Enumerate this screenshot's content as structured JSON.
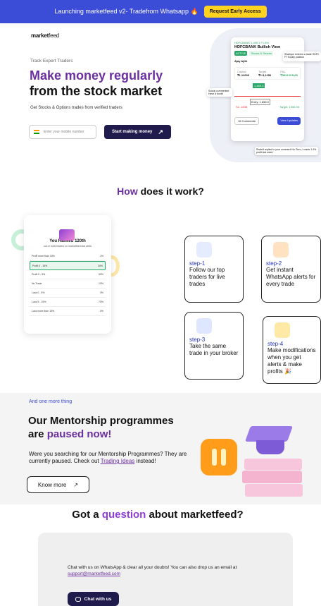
{
  "banner": {
    "text": "Launching marketfeed v2- Tradefrom Whatsapp 🔥",
    "button": "Request Early Access"
  },
  "logo": {
    "bold": "market",
    "rest": "feed"
  },
  "hero": {
    "eyebrow": "Track Expert Traders",
    "title_line1": "Make money regularly",
    "title_line2": "from the stock market",
    "subtitle": "Get Stocks & Options trades from verified traders",
    "phone_placeholder": "Enter your mobile number",
    "cta": "Start making money"
  },
  "trade_card": {
    "symbol": "HDFCBANK 1,455.3 +1.8%",
    "title": "HDFCBANK Bullish View",
    "tag1": "ACTIVE",
    "tag2": "Stocks & Shares",
    "author": "Ajay Ajith",
    "capital_label": "Capital",
    "capital": "₹1,12000",
    "target_label": "Target",
    "target": "₹1.5,1250",
    "pnl_label": "P&L",
    "pnl": "₹5523.5.5420",
    "buy": "1,489.3",
    "entry": "Entry: 1,656.0",
    "sl": "SL: 1838",
    "target_price": "Target: 1556.95",
    "comments": "16 Comments",
    "view_updates": "View Updates",
    "comment1": "Sharique entered a trade HDFC FT Equity position",
    "comment2": "Sooraj commented Have a doubt",
    "comment3": "Shahid replied to your comment No Guru, I made 1.4% profit last week"
  },
  "how": {
    "pre": "How",
    "rest": " does it work?"
  },
  "rank": {
    "title": "You Ranked 120th",
    "sub": "out of 1000 traders on marketfeed last week",
    "rows": [
      {
        "label": "Profit more than 15%",
        "val": "1%"
      },
      {
        "label": "Profit 0 - 15%",
        "val": "34%"
      },
      {
        "label": "Profit 0 - 5%",
        "val": "53%"
      },
      {
        "label": "No Trade",
        "val": "13%"
      },
      {
        "label": "Loss 0 - 5%",
        "val": "3%"
      },
      {
        "label": "Loss 5 - 15%",
        "val": "70%"
      },
      {
        "label": "Loss more than 15%",
        "val": "0%"
      }
    ]
  },
  "steps": [
    {
      "no": "step-1",
      "text": "Follow our top traders for live trades"
    },
    {
      "no": "step-2",
      "text": "Get instant WhatsApp alerts for every trade"
    },
    {
      "no": "step-3",
      "text": "Take the same trade in your broker"
    },
    {
      "no": "step-4",
      "text": "Make modifications when you get alerts & make profits 🎉"
    }
  ],
  "mentor": {
    "eyebrow": "And one more thing",
    "title1": "Our Mentorship programmes",
    "title2_pre": "are ",
    "title2_hl": "paused now!",
    "para": "Were you searching for our Mentorship Programmes? They are currently paused. Check out ",
    "link": "Trading Ideas",
    "para_end": " instead!",
    "button": "Know more"
  },
  "question": {
    "pre": "Got a ",
    "hl": "question",
    "post": " about marketfeed?",
    "text": "Chat with us on WhatsApp & clear all your doubts! You can also drop us an email at ",
    "email": "support@marketfeed.com",
    "button": "Chat with us"
  }
}
